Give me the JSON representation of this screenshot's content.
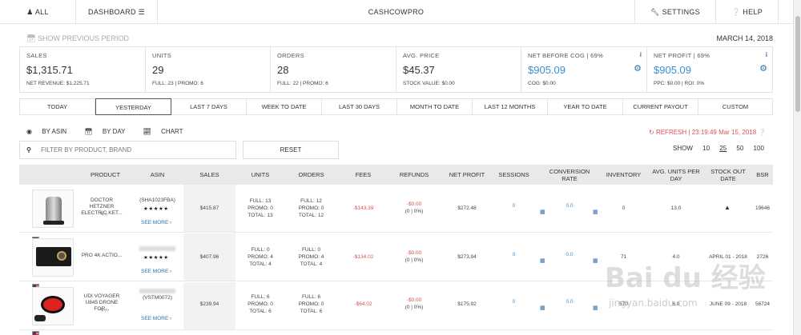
{
  "topbar": {
    "all": "ALL",
    "dashboard": "DASHBOARD",
    "brand": "CASHCOWPRO",
    "settings": "SETTINGS",
    "help": "HELP"
  },
  "show_previous_period": "SHOW PREVIOUS PERIOD",
  "date": "MARCH 14, 2018",
  "metrics": [
    {
      "label": "SALES",
      "value": "$1,315.71",
      "sub": "NET REVENUE: $1,225.71"
    },
    {
      "label": "UNITS",
      "value": "29",
      "sub": "FULL: 23 | PROMO: 6"
    },
    {
      "label": "ORDERS",
      "value": "28",
      "sub": "FULL: 22 | PROMO: 6"
    },
    {
      "label": "AVG. PRICE",
      "value": "$45.37",
      "sub": "STOCK VALUE: $0.00"
    },
    {
      "label": "NET BEFORE COG | 69%",
      "value": "$905.09",
      "sub": "COG: $0.00",
      "info": "i"
    },
    {
      "label": "NET PROFIT | 69%",
      "value": "$905.09",
      "sub": "PPC: $0.00 | ROI: 0%",
      "info": "i"
    }
  ],
  "tabs": [
    "TODAY",
    "YESTERDAY",
    "LAST 7 DAYS",
    "WEEK TO DATE",
    "LAST 30 DAYS",
    "MONTH TO DATE",
    "LAST 12 MONTHS",
    "YEAR TO DATE",
    "CURRENT PAYOUT",
    "CUSTOM"
  ],
  "active_tab": "YESTERDAY",
  "view": {
    "by_asin": "BY ASIN",
    "by_day": "BY DAY",
    "chart": "CHART"
  },
  "refresh": "REFRESH",
  "refresh_time": "23:19:49 Mar 15, 2018",
  "filter_placeholder": "FILTER BY PRODUCT, BRAND",
  "reset": "RESET",
  "show": {
    "label": "SHOW",
    "options": [
      "10",
      "25",
      "50",
      "100"
    ],
    "selected": "25"
  },
  "columns": [
    "PRODUCT",
    "ASIN",
    "SALES",
    "UNITS",
    "ORDERS",
    "FEES",
    "REFUNDS",
    "NET PROFIT",
    "SESSIONS",
    "CONVERSION RATE",
    "INVENTORY",
    "AVG. UNITS PER DAY",
    "STOCK OUT DATE",
    "BSR"
  ],
  "rows": [
    {
      "product": "DOCTOR HETZNER ELECTRIC KET...",
      "asin": "(SHA1023FBA)",
      "stars": "★★★★★",
      "see_more": "SEE MORE",
      "sales": "$415.87",
      "units": [
        "FULL: 13",
        "PROMO: 0",
        "TOTAL: 13"
      ],
      "orders": [
        "FULL: 12",
        "PROMO: 0",
        "TOTAL: 12"
      ],
      "fees": "-$143.39",
      "refunds": [
        "-$0.00",
        "(0 | 0%)"
      ],
      "net_profit": "$272.48",
      "sessions": "0",
      "conversion": "0.0",
      "inventory": "0",
      "avg_units": "13.0",
      "stock_out": "",
      "bsr": "19646"
    },
    {
      "product": "PRO 4K ACTIO...",
      "asin": "",
      "stars": "★★★★★",
      "see_more": "SEE MORE",
      "sales": "$407.96",
      "units": [
        "FULL: 0",
        "PROMO: 4",
        "TOTAL: 4"
      ],
      "orders": [
        "FULL: 0",
        "PROMO: 4",
        "TOTAL: 4"
      ],
      "fees": "-$134.02",
      "refunds": [
        "-$0.00",
        "(0 | 0%)"
      ],
      "net_profit": "$273.94",
      "sessions": "0",
      "conversion": "0.0",
      "inventory": "71",
      "avg_units": "4.0",
      "stock_out": "APRIL 01 - 2018",
      "bsr": "2726"
    },
    {
      "product": "UDI VOYAGER U845 DRONE FOR...",
      "asin": "(VSTM0072)",
      "stars": "",
      "see_more": "SEE MORE",
      "sales": "$239.94",
      "units": [
        "FULL: 6",
        "PROMO: 0",
        "TOTAL: 6"
      ],
      "orders": [
        "FULL: 6",
        "PROMO: 0",
        "TOTAL: 6"
      ],
      "fees": "-$64.02",
      "refunds": [
        "-$0.00",
        "(0 | 0%)"
      ],
      "net_profit": "$175.92",
      "sessions": "0",
      "conversion": "0.0",
      "inventory": "570",
      "avg_units": "6.0",
      "stock_out": "JUNE 09 - 2018",
      "bsr": "56724"
    }
  ],
  "watermark": {
    "text": "Bai du 经验",
    "url": "jingyan.baidu.com"
  }
}
